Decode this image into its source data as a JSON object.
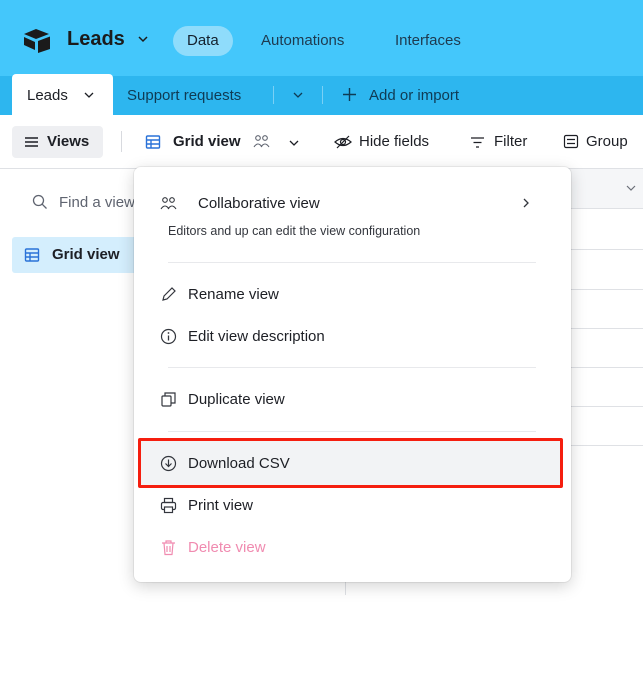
{
  "colors": {
    "header": "#44c7fb",
    "tabbar": "#2db6ef",
    "highlight_border": "#f51e0f",
    "delete_text": "#f08bb0",
    "selected_view": "#d4eefd"
  },
  "header": {
    "logo_icon": "airtable-logo",
    "base_name": "Leads",
    "nav": [
      {
        "label": "Data",
        "active": true
      },
      {
        "label": "Automations",
        "active": false
      },
      {
        "label": "Interfaces",
        "active": false
      }
    ]
  },
  "tabs": {
    "active": "Leads",
    "other": "Support requests",
    "add": "Add or import"
  },
  "toolbar": {
    "views": "Views",
    "current_view": "Grid view",
    "hide_fields": "Hide fields",
    "filter": "Filter",
    "group": "Group"
  },
  "sidebar": {
    "search_placeholder": "Find a view",
    "items": [
      {
        "label": "Grid view",
        "icon": "grid-icon"
      }
    ]
  },
  "menu": {
    "collaborative": {
      "label": "Collaborative view",
      "description": "Editors and up can edit the view configuration",
      "icon": "collaborative-icon"
    },
    "items": [
      {
        "label": "Rename view",
        "icon": "pencil-icon"
      },
      {
        "label": "Edit view description",
        "icon": "info-icon"
      },
      {
        "label": "Duplicate view",
        "icon": "duplicate-icon"
      },
      {
        "label": "Download CSV",
        "icon": "download-icon",
        "highlighted": true
      },
      {
        "label": "Print view",
        "icon": "printer-icon"
      },
      {
        "label": "Delete view",
        "icon": "trash-icon",
        "destructive": true
      }
    ]
  }
}
